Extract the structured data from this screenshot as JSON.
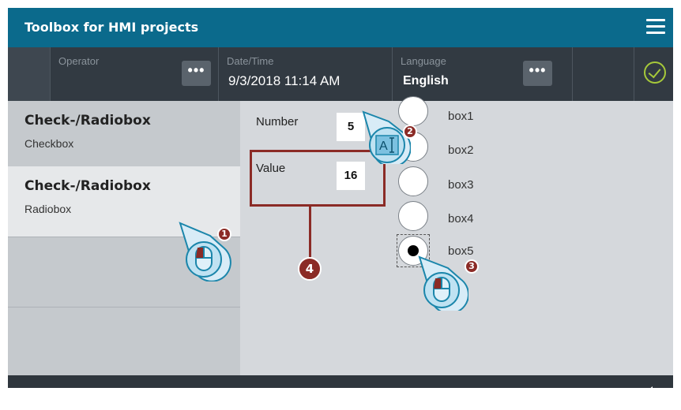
{
  "titlebar": {
    "title": "Toolbox for HMI projects",
    "menu_icon": "hamburger-menu-icon"
  },
  "statusbar": {
    "operator_label": "Operator",
    "datetime_label": "Date/Time",
    "datetime_value": "9/3/2018 11:14 AM",
    "language_label": "Language",
    "language_value": "English",
    "more_button_label": "•••",
    "confirm_icon": "checkmark-circle-icon"
  },
  "sidebar": {
    "items": [
      {
        "title": "Check-/Radiobox",
        "subtitle": "Checkbox"
      },
      {
        "title": "Check-/Radiobox",
        "subtitle": "Radiobox"
      }
    ]
  },
  "content": {
    "number_label": "Number",
    "number_value": "5",
    "value_label": "Value",
    "value_value": "16",
    "radio_boxes": [
      {
        "label": "box1",
        "selected": false
      },
      {
        "label": "box2",
        "selected": false
      },
      {
        "label": "box3",
        "selected": false
      },
      {
        "label": "box4",
        "selected": false
      },
      {
        "label": "box5",
        "selected": true
      }
    ]
  },
  "annotations": {
    "marker_1": "1",
    "marker_2": "2",
    "marker_3": "3",
    "marker_4": "4",
    "keyboard_badge": "A",
    "accent_color": "#8b2b26"
  },
  "footer": {
    "back_icon": "back-arrow-icon"
  },
  "colors": {
    "titlebar": "#0b6a8c",
    "statusbar": "#323a42",
    "confirm": "#a6c93a",
    "annotation": "#8b2b26"
  }
}
